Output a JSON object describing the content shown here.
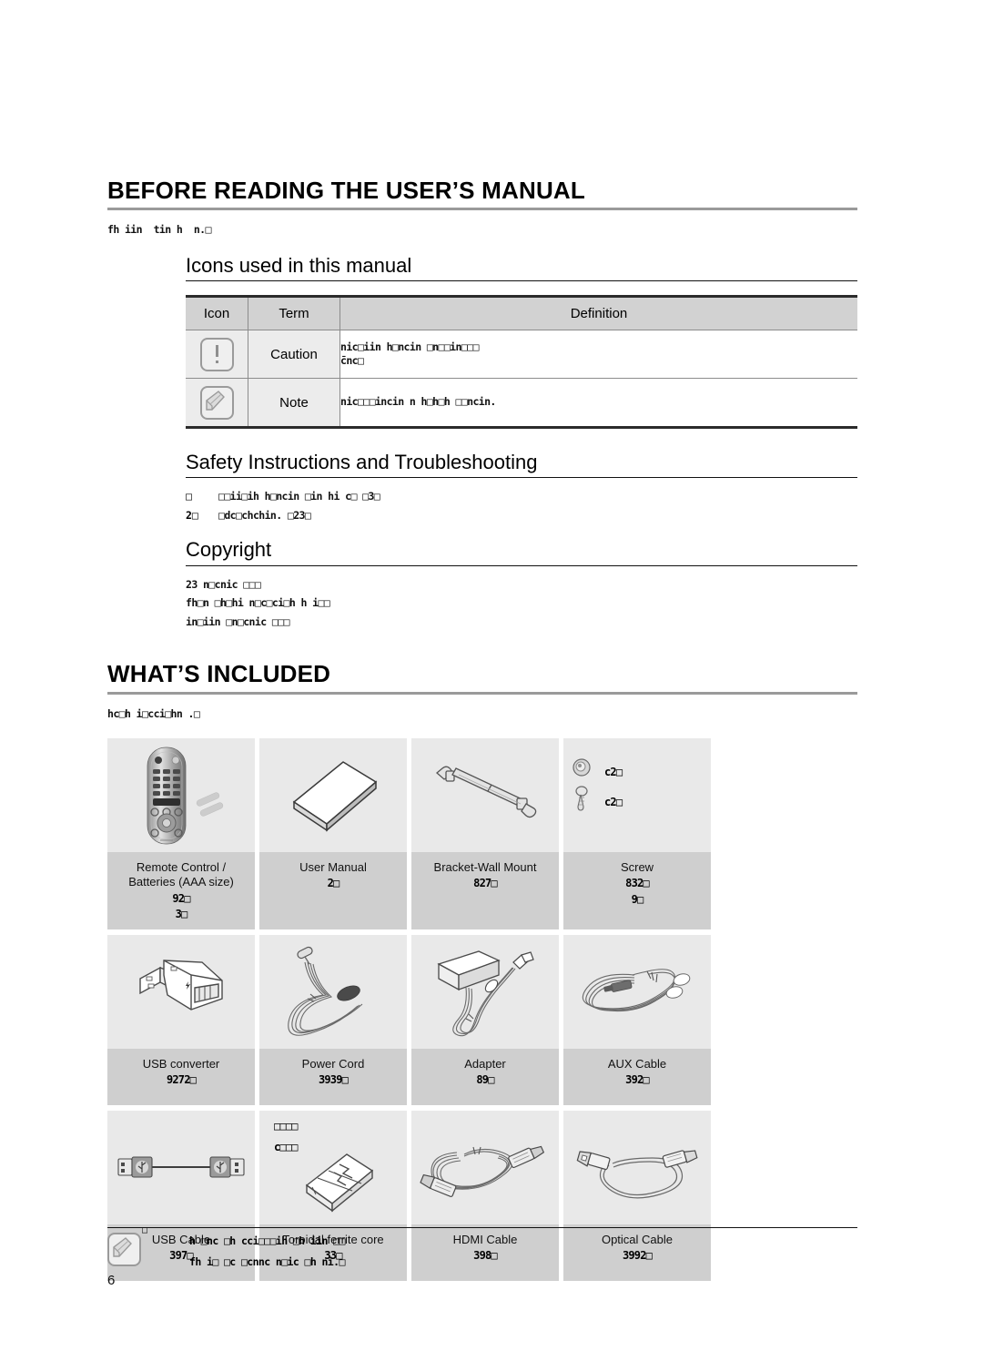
{
  "page": {
    "number": "6"
  },
  "section1": {
    "heading": "BEFORE READING THE USER’S MANUAL",
    "intro_garbled": "fh iin  tin h  n.□",
    "sub1": {
      "heading": "Icons used in this manual",
      "table": {
        "headers": [
          "Icon",
          "Term",
          "Definition"
        ],
        "rows": [
          {
            "icon": "caution-icon",
            "term": "Caution",
            "definition_line1": "nic□iin h□ncin □n□□in□□□",
            "definition_line2": "c̄nc□"
          },
          {
            "icon": "note-icon",
            "term": "Note",
            "definition_line1": "nic□□□incin n h□h□h □□ncin.",
            "definition_line2": ""
          }
        ]
      }
    },
    "sub2": {
      "heading": "Safety Instructions and Troubleshooting",
      "bullets": [
        {
          "mark": "□",
          "text": "□□ii□ih h□ncin □in hi c□ □3□"
        },
        {
          "mark": "2□",
          "text": "□dc□chchin. □23□"
        }
      ]
    },
    "sub3": {
      "heading": "Copyright",
      "lines": [
        "23 n□cnic □□□",
        "fh□n □h□hi n□c□ci□h h i□□",
        "in□iin □n□cnic □□□"
      ]
    }
  },
  "section2": {
    "heading": "WHAT’S INCLUDED",
    "intro_garbled": "hc□h i□cci□hn .□",
    "items": [
      {
        "name": "remote-control",
        "title": "Remote Control /\nBatteries (AAA size)",
        "codes": [
          "92□",
          "3□"
        ],
        "icon": "remote-control-icon"
      },
      {
        "name": "user-manual",
        "title": "User Manual",
        "codes": [
          "2□"
        ],
        "icon": "booklet-icon"
      },
      {
        "name": "bracket-wall-mount",
        "title": "Bracket-Wall Mount",
        "codes": [
          "827□"
        ],
        "icon": "wall-bracket-icon"
      },
      {
        "name": "screw",
        "title": "Screw",
        "codes": [
          "832□",
          "9□"
        ],
        "icon": "screw-icon",
        "mini_codes": [
          "c2□",
          "c2□"
        ]
      },
      {
        "name": "usb-converter",
        "title": "USB converter",
        "codes": [
          "9272□"
        ],
        "icon": "usb-converter-icon"
      },
      {
        "name": "power-cord",
        "title": "Power Cord",
        "codes": [
          "3939□"
        ],
        "icon": "power-cord-icon"
      },
      {
        "name": "adapter",
        "title": "Adapter",
        "codes": [
          "89□"
        ],
        "icon": "adapter-icon"
      },
      {
        "name": "aux-cable",
        "title": "AUX Cable",
        "codes": [
          "392□"
        ],
        "icon": "aux-cable-icon"
      },
      {
        "name": "usb-cable",
        "title": "USB Cable",
        "codes": [
          "397□"
        ],
        "icon": "usb-cable-icon"
      },
      {
        "name": "toroidal-ferrite-core",
        "title": "Toroidal ferrite core",
        "codes": [
          "33□"
        ],
        "icon": "ferrite-core-icon",
        "ferrite_codes": [
          "□□□□",
          "c□□□"
        ]
      },
      {
        "name": "hdmi-cable",
        "title": "HDMI Cable",
        "codes": [
          "398□"
        ],
        "icon": "hdmi-cable-icon"
      },
      {
        "name": "optical-cable",
        "title": "Optical Cable",
        "codes": [
          "3992□"
        ],
        "icon": "optical-cable-icon"
      }
    ]
  },
  "footer": {
    "icon": "note-icon",
    "marker": "□",
    "lines": [
      "h □nc □h cci□□□ih □h iin □□",
      "fh i□ □c □cnnc n□ic □h ni.□"
    ]
  },
  "colors": {
    "rule_gray": "#9a9a9a",
    "table_header_bg": "#d2d2d2",
    "cell_image_bg": "#e9e9e9",
    "cell_caption_bg": "#cfcfcf"
  }
}
